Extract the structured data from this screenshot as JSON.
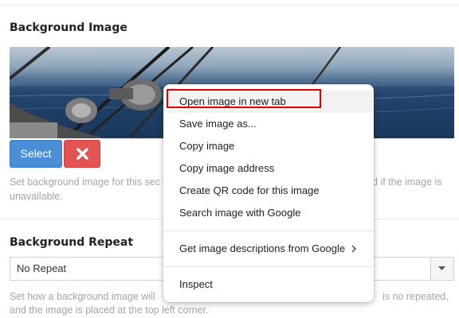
{
  "background_section": {
    "title": "Background Image",
    "select_label": "Select",
    "help_part1": "Set background image for this sec",
    "help_part2": "d if the image is",
    "help_line2": "unavailable."
  },
  "repeat_section": {
    "title": "Background Repeat",
    "selected_value": "No Repeat",
    "help_part1": "Set how a background image will",
    "help_part2": "is no repeated,",
    "help_line2": "and the image is placed at the top left corner."
  },
  "context_menu": {
    "items": [
      "Open image in new tab",
      "Save image as...",
      "Copy image",
      "Copy image address",
      "Create QR code for this image",
      "Search image with Google",
      "Get image descriptions from Google",
      "Inspect"
    ]
  },
  "colors": {
    "select_button": "#4a8fd6",
    "remove_button": "#e35351",
    "highlight": "#e00000"
  },
  "icons": {
    "remove": "close-icon",
    "dropdown": "caret-down-icon",
    "submenu": "chevron-right-icon"
  }
}
